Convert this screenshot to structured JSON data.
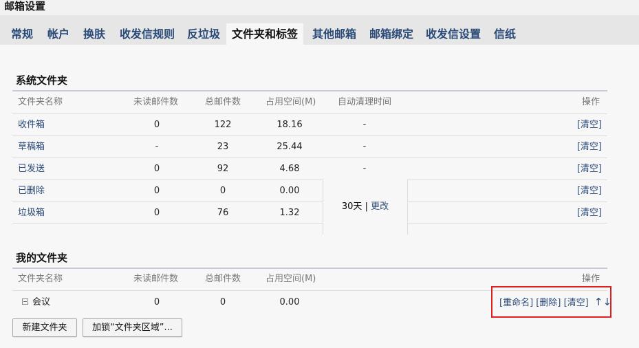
{
  "page_title": "邮箱设置",
  "tabs": [
    {
      "label": "常规"
    },
    {
      "label": "帐户"
    },
    {
      "label": "换肤"
    },
    {
      "label": "收发信规则"
    },
    {
      "label": "反垃圾"
    },
    {
      "label": "文件夹和标签",
      "active": true
    },
    {
      "label": "其他邮箱"
    },
    {
      "label": "邮箱绑定"
    },
    {
      "label": "收发信设置"
    },
    {
      "label": "信纸"
    }
  ],
  "system_folders": {
    "title": "系统文件夹",
    "headers": {
      "name": "文件夹名称",
      "unread": "未读邮件数",
      "total": "总邮件数",
      "size": "占用空间(M)",
      "auto_clean": "自动清理时间",
      "op": "操作"
    },
    "rows": [
      {
        "name": "收件箱",
        "unread": "0",
        "total": "122",
        "size": "18.16",
        "auto_clean": "-",
        "op": "[清空]"
      },
      {
        "name": "草稿箱",
        "unread": "-",
        "total": "23",
        "size": "25.44",
        "auto_clean": "-",
        "op": "[清空]"
      },
      {
        "name": "已发送",
        "unread": "0",
        "total": "92",
        "size": "4.68",
        "auto_clean": "-",
        "op": "[清空]"
      },
      {
        "name": "已删除",
        "unread": "0",
        "total": "0",
        "size": "0.00",
        "op": "[清空]"
      },
      {
        "name": "垃圾箱",
        "unread": "0",
        "total": "76",
        "size": "1.32",
        "op": "[清空]"
      }
    ],
    "auto_clean_merged": {
      "days": "30天",
      "separator": " | ",
      "change": "更改"
    }
  },
  "my_folders": {
    "title": "我的文件夹",
    "headers": {
      "name": "文件夹名称",
      "unread": "未读邮件数",
      "total": "总邮件数",
      "size": "占用空间(M)",
      "op": "操作"
    },
    "rows": [
      {
        "name": "会议",
        "unread": "0",
        "total": "0",
        "size": "0.00",
        "rename": "[重命名]",
        "delete": "[删除]",
        "clear": "[清空]",
        "up": "↑",
        "down": "↓"
      }
    ]
  },
  "buttons": {
    "new_folder": "新建文件夹",
    "lock_folder": "加锁“文件夹区域”..."
  },
  "colors": {
    "link": "#2a4a78",
    "highlight_border": "#e02020"
  }
}
